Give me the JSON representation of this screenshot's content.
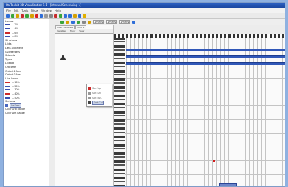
{
  "window": {
    "title": "lfa Toolkit 3D Visualization 1.1 - [interval Scheduling 1]"
  },
  "menu": [
    "File",
    "Edit",
    "Tools",
    "Show",
    "Window",
    "Help"
  ],
  "toolbar": {
    "icons": [
      "new-icon",
      "open-icon",
      "save-icon",
      "cut-icon",
      "copy-icon",
      "paste-icon",
      "record-icon",
      "stop-icon",
      "chart-icon",
      "brush-icon",
      "pencil-icon",
      "tool-icon",
      "globe-icon",
      "zoom-icon",
      "help-icon",
      "info-icon",
      "star-icon"
    ],
    "colors": [
      "#2f6ed8",
      "#3aa53a",
      "#d6a100",
      "#c72b2b",
      "#3aa53a",
      "#d6a100",
      "#d82020",
      "#2f6ed8",
      "#999999",
      "#888888",
      "#c72b2b",
      "#3aa53a",
      "#2f6ed8",
      "#2f6ed8",
      "#d6a100",
      "#2f6ed8",
      "#e0b000"
    ]
  },
  "toolbar2": {
    "field1": "1mm/s",
    "field2": "1mm/s",
    "field3": "1mm/s"
  },
  "sidebar": {
    "items": [
      {
        "label": "Lenses",
        "type": "header"
      },
      {
        "label": "— 2%",
        "color": "#3a4fb0"
      },
      {
        "label": "— 4%",
        "color": "#3a4fb0"
      },
      {
        "label": "— 6%",
        "color": "#cc2a2a"
      },
      {
        "label": "— 8%",
        "color": "#3a4fb0"
      },
      {
        "label": "Structures",
        "type": "header"
      },
      {
        "label": "Links",
        "type": "header"
      },
      {
        "label": "Lens alignment",
        "type": "header"
      },
      {
        "label": "Gatekeepers",
        "type": "header"
      },
      {
        "label": "Subjects",
        "type": "header"
      },
      {
        "label": "Types",
        "type": "header"
      },
      {
        "label": "Lineage",
        "type": "header"
      },
      {
        "label": "Outcome",
        "type": "header"
      },
      {
        "label": "Output 1 Area",
        "type": "header"
      },
      {
        "label": "Output 2 Area",
        "type": "header"
      },
      {
        "label": "Line Colors",
        "type": "header"
      },
      {
        "label": "— 10%",
        "color": "#cc2a2a"
      },
      {
        "label": "— 20%",
        "color": "#3a4fb0"
      },
      {
        "label": "— 30%",
        "color": "#3a4fb0"
      },
      {
        "label": "— 40%",
        "color": "#cc2a2a"
      },
      {
        "label": "— 50%",
        "color": "#3a4fb0"
      },
      {
        "label": "Surfaces",
        "type": "header"
      },
      {
        "label": "Surface",
        "type": "selected"
      },
      {
        "label": "Color Grid Range",
        "type": "header"
      },
      {
        "label": "Color Dim Range",
        "type": "header"
      }
    ]
  },
  "panel": {
    "tabs": [
      "Multi Variables",
      "Tutor 1"
    ],
    "subtabs": [
      "Variables",
      "Tutor",
      "View"
    ]
  },
  "popup": {
    "items": [
      {
        "label": "Sort Up",
        "icon_color": "#cc2a2a"
      },
      {
        "label": "Sort Dn",
        "icon_color": "#999999"
      },
      {
        "label": "Sort By...",
        "icon_color": "#999999"
      },
      {
        "label": "Sort Col",
        "icon_color": "#444444",
        "active": true
      }
    ]
  }
}
